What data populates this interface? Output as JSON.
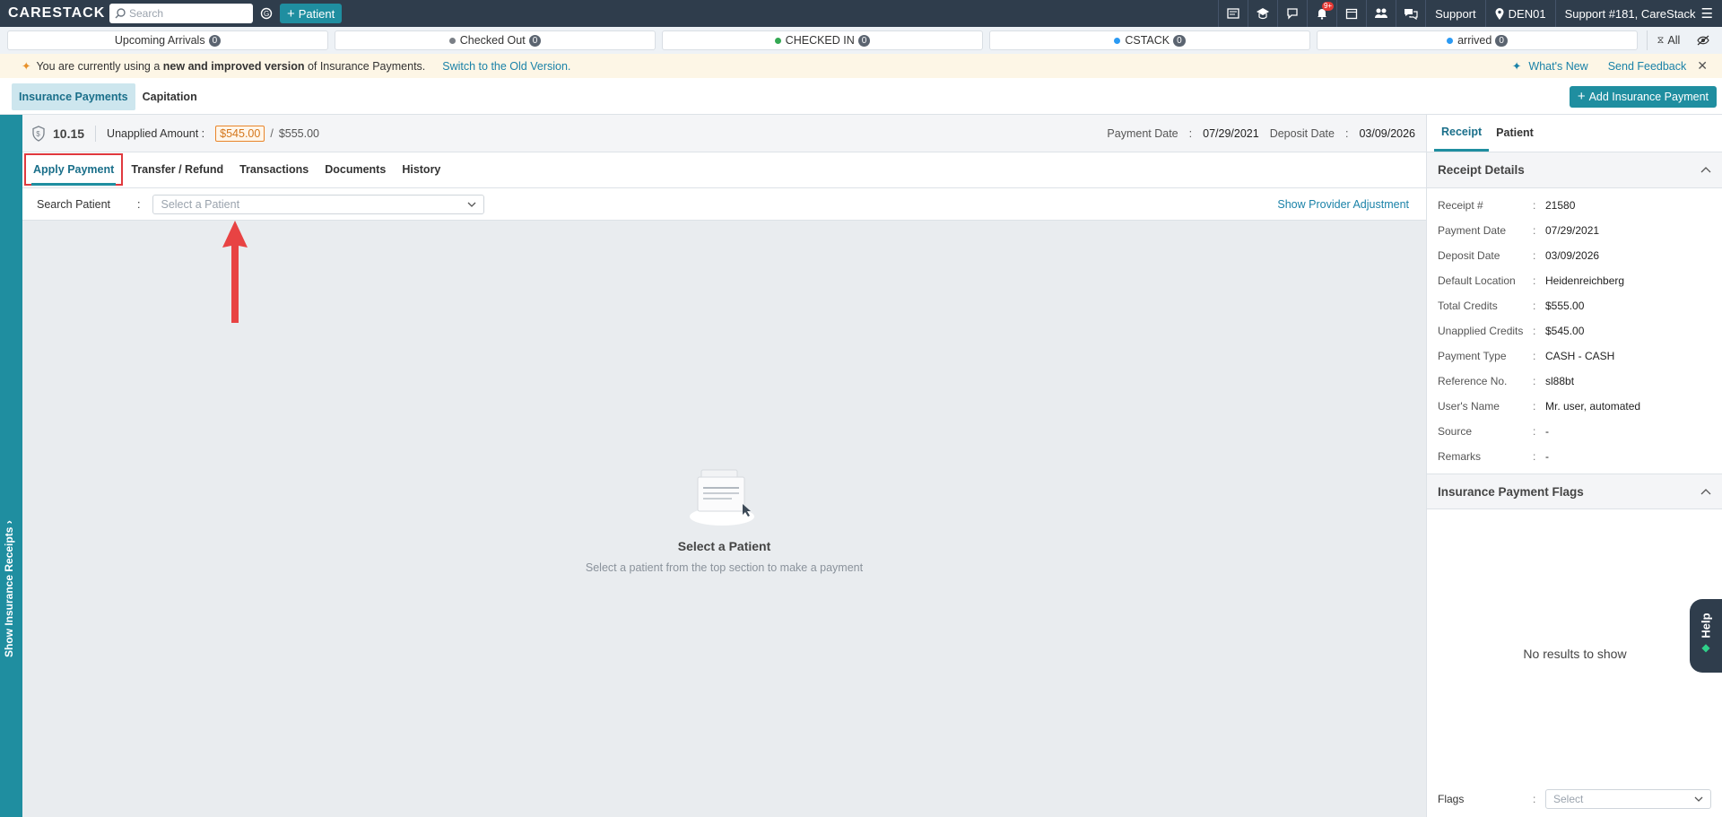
{
  "topbar": {
    "logo": "CARESTACK",
    "search_placeholder": "Search",
    "patient_button": "Patient",
    "notification_badge": "9+",
    "support_label": "Support",
    "location": "DEN01",
    "user": "Support #181, CareStack"
  },
  "status_bar": {
    "items": [
      {
        "label": "Upcoming Arrivals",
        "count": "0",
        "dot": ""
      },
      {
        "label": "Checked Out",
        "count": "0",
        "dot": "#7a7f86"
      },
      {
        "label": "CHECKED IN",
        "count": "0",
        "dot": "#34a853"
      },
      {
        "label": "CSTACK",
        "count": "0",
        "dot": "#2b9af3"
      },
      {
        "label": "arrived",
        "count": "0",
        "dot": "#2b9af3"
      }
    ],
    "all_label": "All"
  },
  "banner": {
    "prefix": "You are currently using a ",
    "bold": "new and improved version",
    "suffix": " of Insurance Payments.",
    "switch_link": "Switch to the Old Version.",
    "whats_new": "What's New",
    "send_feedback": "Send Feedback"
  },
  "tabs": {
    "insurance_payments": "Insurance Payments",
    "capitation": "Capitation",
    "add_button": "Add Insurance Payment"
  },
  "left_rail": {
    "label": "Show Insurance Receipts"
  },
  "payment_header": {
    "id": "10.15",
    "unapplied_label": "Unapplied Amount :",
    "unapplied_amount": "$545.00",
    "separator": "/",
    "total_amount": "$555.00",
    "payment_date_label": "Payment Date",
    "payment_date": "07/29/2021",
    "deposit_date_label": "Deposit Date",
    "deposit_date": "03/09/2026",
    "colon": ":"
  },
  "sub_tabs": [
    "Apply Payment",
    "Transfer / Refund",
    "Transactions",
    "Documents",
    "History"
  ],
  "search_row": {
    "label": "Search Patient",
    "colon": ":",
    "placeholder": "Select a Patient",
    "provider_adjustment_link": "Show Provider Adjustment"
  },
  "empty_state": {
    "title": "Select a Patient",
    "subtitle": "Select a patient from the top section to make a payment"
  },
  "right_panel": {
    "tabs": [
      "Receipt",
      "Patient"
    ],
    "receipt_details_title": "Receipt Details",
    "details": [
      {
        "k": "Receipt #",
        "v": "21580"
      },
      {
        "k": "Payment Date",
        "v": "07/29/2021"
      },
      {
        "k": "Deposit Date",
        "v": "03/09/2026"
      },
      {
        "k": "Default Location",
        "v": "Heidenreichberg"
      },
      {
        "k": "Total Credits",
        "v": "$555.00"
      },
      {
        "k": "Unapplied Credits",
        "v": "$545.00"
      },
      {
        "k": "Payment Type",
        "v": "CASH - CASH"
      },
      {
        "k": "Reference No.",
        "v": "sl88bt"
      },
      {
        "k": "User's Name",
        "v": "Mr. user, automated"
      },
      {
        "k": "Source",
        "v": "-"
      },
      {
        "k": "Remarks",
        "v": "-"
      }
    ],
    "flags_title": "Insurance Payment Flags",
    "no_results": "No results to show",
    "flags_label": "Flags",
    "flags_placeholder": "Select"
  },
  "help": {
    "label": "Help"
  },
  "colors": {
    "accent": "#1f8ea0",
    "topbar": "#2f3d4c",
    "highlight": "#e0393e"
  }
}
